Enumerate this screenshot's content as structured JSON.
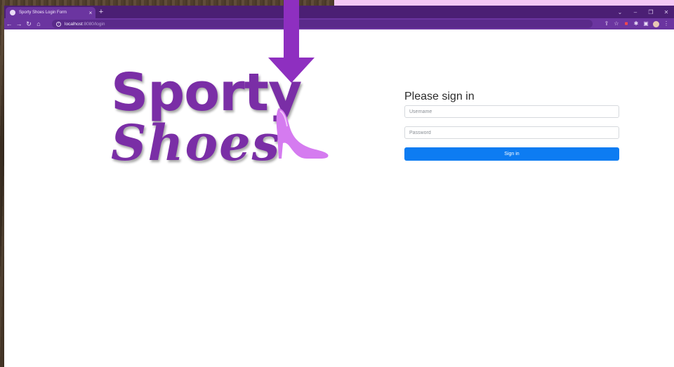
{
  "browser": {
    "tab_title": "Sporty Shoes Login Form",
    "tab_close": "×",
    "new_tab": "+",
    "url_host": "localhost",
    "url_path": ":8080/login",
    "window_controls": [
      "⌄",
      "–",
      "❐",
      "✕"
    ]
  },
  "logo": {
    "line1": "Sporty",
    "line2": "Shoes"
  },
  "login": {
    "title": "Please sign in",
    "username_placeholder": "Username",
    "password_placeholder": "Password",
    "signin_label": "Sign in"
  },
  "colors": {
    "brand_purple": "#7a2ea6",
    "heel_pink": "#d57bf0",
    "button_blue": "#0d7cf2",
    "browser_frame": "#4b1f74",
    "arrow_purple": "#8e2fc0"
  },
  "icons": {
    "back": "back-arrow-icon",
    "forward": "forward-arrow-icon",
    "reload": "reload-icon",
    "home": "home-icon",
    "info": "info-icon",
    "share": "share-icon",
    "bookmark": "star-icon",
    "pdf": "pdf-extension-icon",
    "extensions": "puzzle-icon",
    "sidepanel": "side-panel-icon",
    "profile": "profile-avatar-icon",
    "menu": "kebab-menu-icon",
    "heel": "high-heel-icon"
  }
}
